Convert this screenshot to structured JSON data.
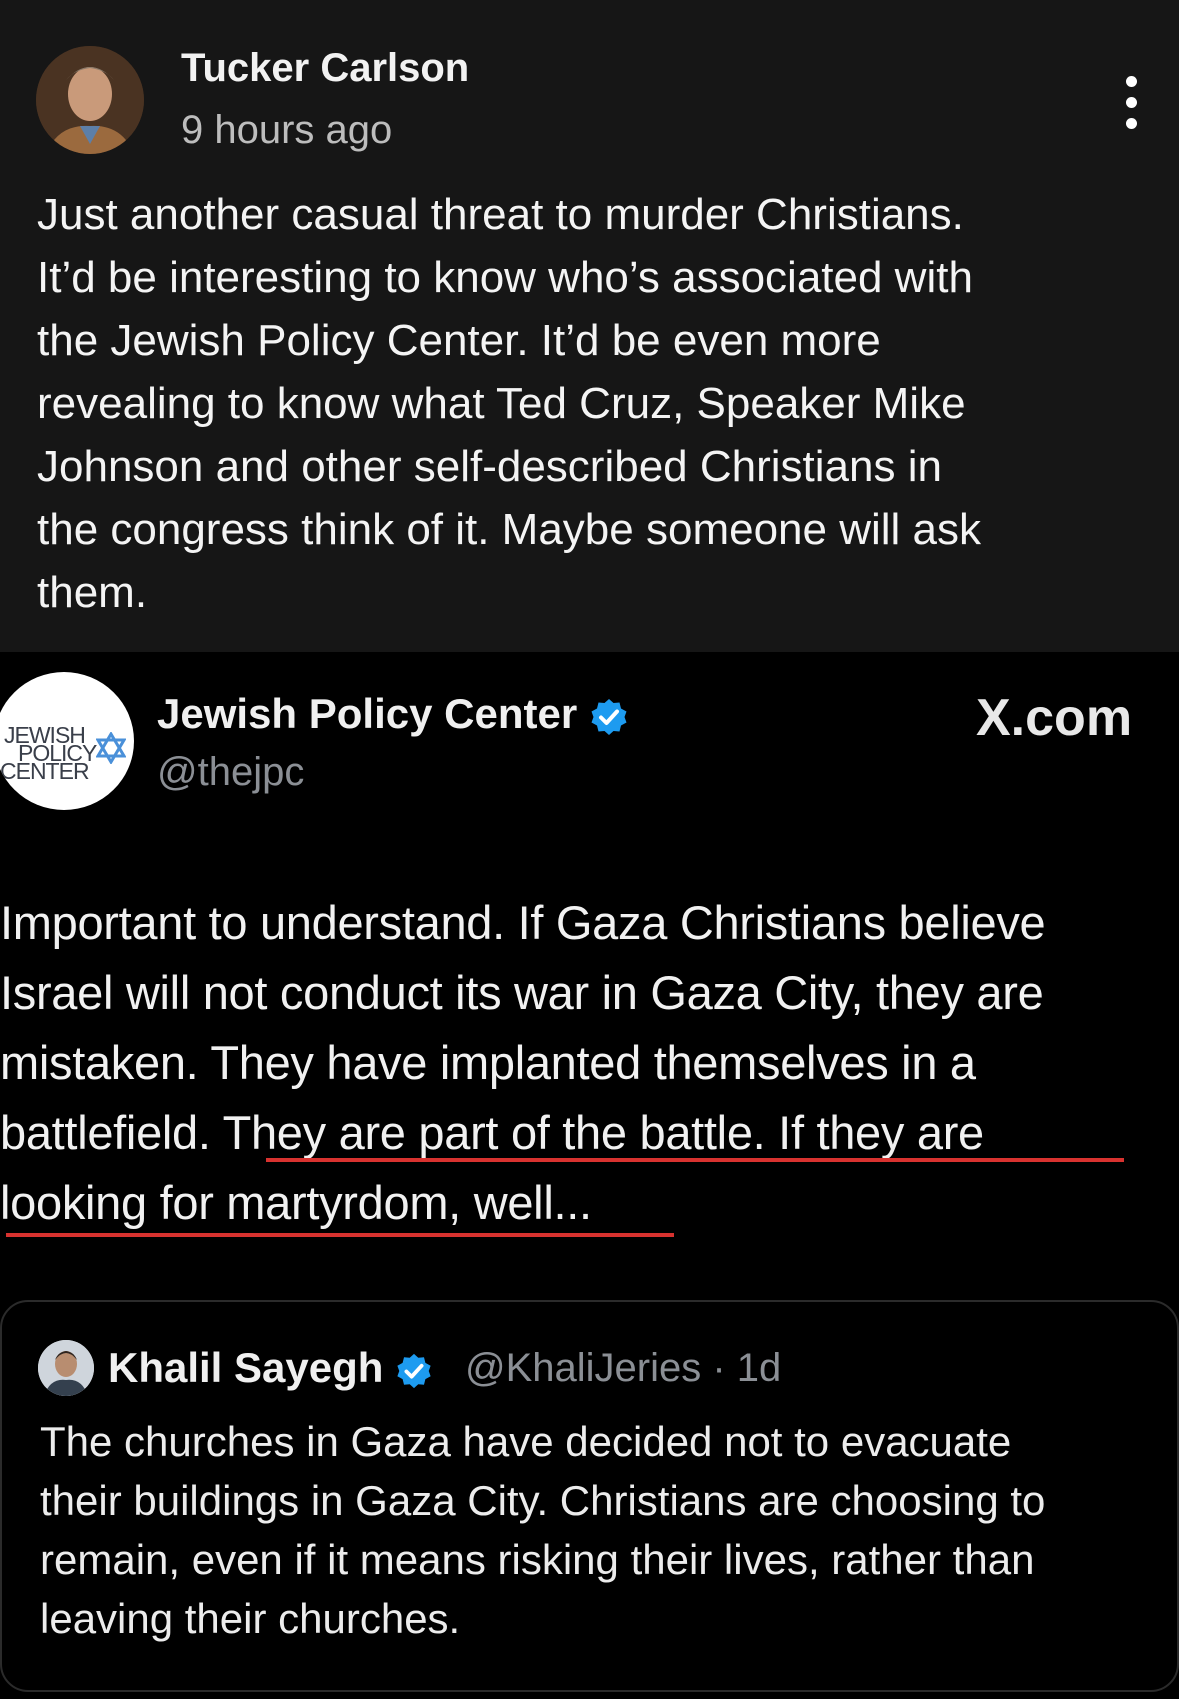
{
  "post": {
    "author": "Tucker Carlson",
    "time": "9 hours ago",
    "text_lines": [
      "Just another casual threat to murder Christians.",
      "It’d be interesting to know who’s associated with",
      "the Jewish Policy Center. It’d be even more",
      "revealing to know what Ted Cruz, Speaker Mike",
      "Johnson and other self-described Christians in",
      "the congress think of it. Maybe someone will ask",
      "them."
    ]
  },
  "embedded_tweet": {
    "logo_text": [
      "JEWISH",
      "POLICY",
      "CENTER"
    ],
    "name": "Jewish Policy Center",
    "handle": "@thejpc",
    "source": "X.com",
    "body_lines": [
      "Important to understand. If Gaza Christians believe",
      "Israel will not conduct its war in Gaza City, they are",
      "mistaken. They have implanted themselves in a",
      "battlefield. They are part of the battle. If they are",
      "looking for martyrdom, well..."
    ],
    "highlight_color": "#d8322f"
  },
  "quoted_tweet": {
    "name": "Khalil Sayegh",
    "handle_time": "@KhaliJeries · 1d",
    "body_lines": [
      "The churches in Gaza have decided not to evacuate",
      "their buildings in Gaza City. Christians are choosing to",
      "remain, even if it means risking their lives, rather than",
      "leaving their churches."
    ]
  },
  "colors": {
    "verified_blue": "#1d9bf0",
    "post_background": "#161616",
    "tweet_background": "#000000"
  }
}
